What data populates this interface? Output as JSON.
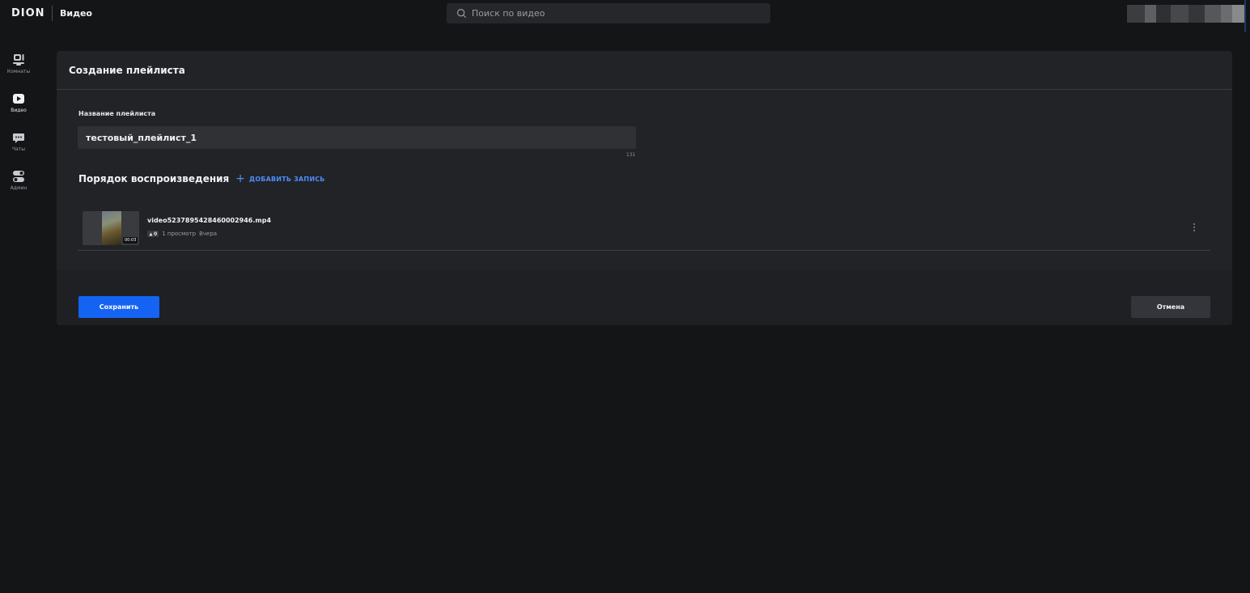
{
  "header": {
    "logo": "DION",
    "section": "Видео",
    "search_placeholder": "Поиск по видео"
  },
  "rail": {
    "items": [
      {
        "label": "Комнаты",
        "icon": "rooms-icon"
      },
      {
        "label": "Видео",
        "icon": "video-icon"
      },
      {
        "label": "Чаты",
        "icon": "chats-icon"
      },
      {
        "label": "Админ",
        "icon": "admin-icon"
      }
    ]
  },
  "dialog": {
    "title": "Создание плейлиста",
    "name_label": "Название плейлиста",
    "name_value": "тестовый_плейлист_1",
    "name_counter": "131",
    "order_title": "Порядок воспроизведения",
    "add_label": "ДОБАВИТЬ ЗАПИСЬ",
    "videos": [
      {
        "name": "video5237895428460002946.mp4",
        "duration": "00:03",
        "badge": "0",
        "views": "1 просмотр",
        "date": "Вчера"
      }
    ],
    "save_label": "Сохранить",
    "cancel_label": "Отмена"
  },
  "colors": {
    "accent": "#1463f3",
    "link": "#4d8dff",
    "background": "#141517",
    "panel": "#222326"
  }
}
